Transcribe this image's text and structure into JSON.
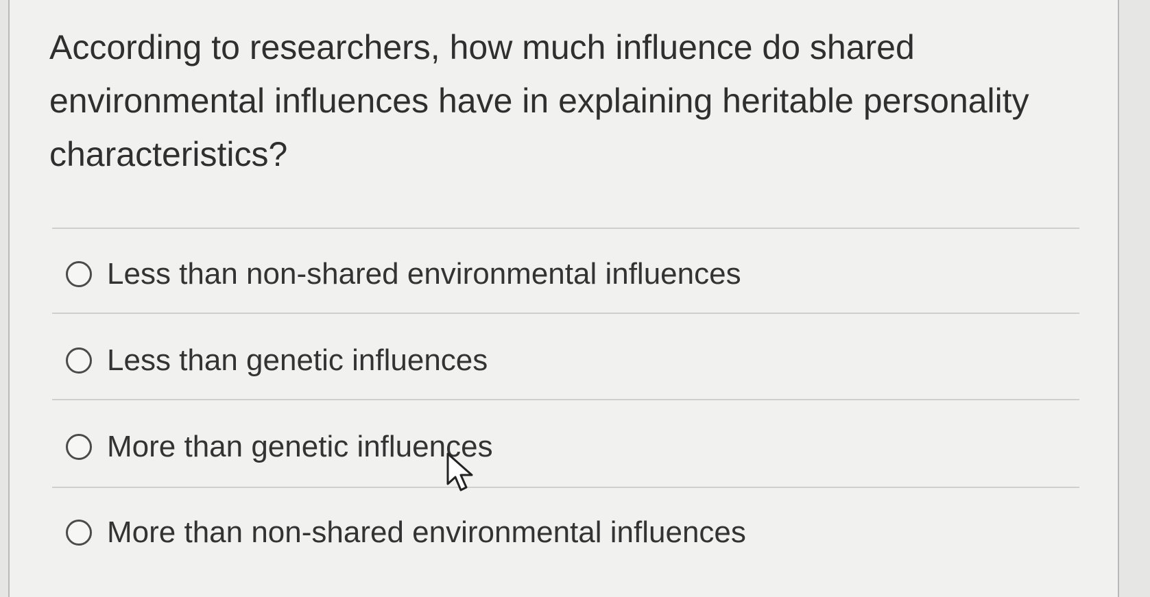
{
  "question": {
    "text": "According to researchers, how much influence do shared environmental influences have in explaining heritable personality characteristics?"
  },
  "options": [
    {
      "label": "Less than non-shared environmental influences",
      "selected": false
    },
    {
      "label": "Less than genetic influences",
      "selected": false
    },
    {
      "label": "More than genetic influences",
      "selected": false
    },
    {
      "label": "More than non-shared environmental influences",
      "selected": false
    }
  ],
  "icons": {
    "radio": "radio-unchecked-icon",
    "cursor": "mouse-pointer-icon"
  },
  "colors": {
    "background": "#f1f1ef",
    "text": "#333333",
    "divider": "#cfcfcd",
    "radio_border": "#4b4b4b"
  }
}
